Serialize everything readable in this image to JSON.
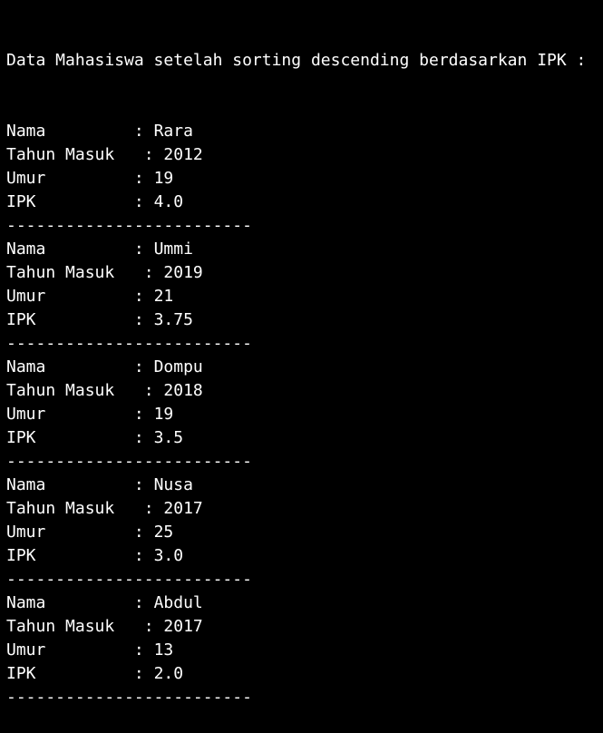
{
  "colors": {
    "background": "#000000",
    "foreground": "#ffffff"
  },
  "console": {
    "header": "Data Mahasiswa setelah sorting descending berdasarkan IPK :",
    "separator": "-------------------------",
    "field_labels": {
      "nama": "Nama         : ",
      "tahun_masuk": "Tahun Masuk   : ",
      "umur": "Umur         : ",
      "ipk": "IPK          : "
    },
    "records": [
      {
        "nama": "Rara",
        "tahun_masuk": "2012",
        "umur": "19",
        "ipk": "4.0"
      },
      {
        "nama": "Ummi",
        "tahun_masuk": "2019",
        "umur": "21",
        "ipk": "3.75"
      },
      {
        "nama": "Dompu",
        "tahun_masuk": "2018",
        "umur": "19",
        "ipk": "3.5"
      },
      {
        "nama": "Nusa",
        "tahun_masuk": "2017",
        "umur": "25",
        "ipk": "3.0"
      },
      {
        "nama": "Abdul",
        "tahun_masuk": "2017",
        "umur": "13",
        "ipk": "2.0"
      }
    ]
  }
}
